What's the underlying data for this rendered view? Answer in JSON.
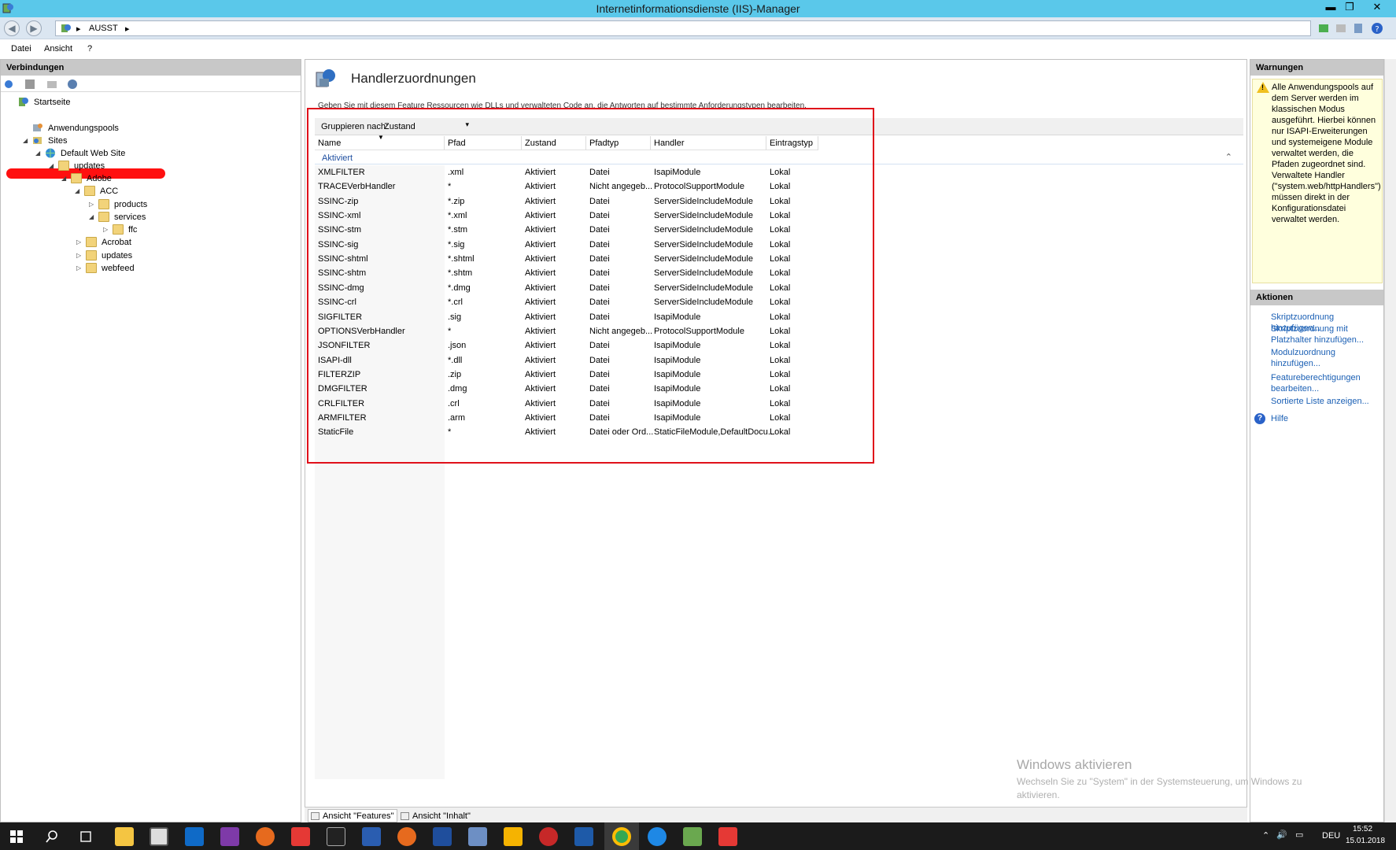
{
  "window": {
    "title": "Internetinformationsdienste (IIS)-Manager"
  },
  "address": {
    "crumb": "AUSST"
  },
  "menu": [
    "Datei",
    "Ansicht",
    "?"
  ],
  "connections": {
    "header": "Verbindungen",
    "tree": [
      {
        "label": "Startseite",
        "icon": "server-icon",
        "redacted": true
      },
      {
        "label": "Anwendungspools",
        "icon": "app-pools-icon"
      },
      {
        "label": "Sites",
        "icon": "sites-icon"
      },
      {
        "label": "Default Web Site",
        "icon": "globe-icon"
      },
      {
        "label": "updates",
        "icon": "folder-icon"
      },
      {
        "label": "Adobe",
        "icon": "folder-icon"
      },
      {
        "label": "ACC",
        "icon": "folder-icon"
      },
      {
        "label": "products",
        "icon": "folder-icon"
      },
      {
        "label": "services",
        "icon": "folder-icon"
      },
      {
        "label": "ffc",
        "icon": "folder-icon"
      },
      {
        "label": "Acrobat",
        "icon": "folder-icon"
      },
      {
        "label": "updates",
        "icon": "folder-icon"
      },
      {
        "label": "webfeed",
        "icon": "folder-icon"
      }
    ]
  },
  "feature": {
    "title": "Handlerzuordnungen",
    "description": "Geben Sie mit diesem Feature Ressourcen wie DLLs und verwalteten Code an, die Antworten auf bestimmte Anforderungstypen bearbeiten.",
    "group_by_label": "Gruppieren nach:",
    "group_by_value": "Zustand",
    "group_name": "Aktiviert",
    "columns": [
      "Name",
      "Pfad",
      "Zustand",
      "Pfadtyp",
      "Handler",
      "Eintragstyp"
    ],
    "rows": [
      [
        "XMLFILTER",
        ".xml",
        "Aktiviert",
        "Datei",
        "IsapiModule",
        "Lokal"
      ],
      [
        "TRACEVerbHandler",
        "*",
        "Aktiviert",
        "Nicht angegeb...",
        "ProtocolSupportModule",
        "Lokal"
      ],
      [
        "SSINC-zip",
        "*.zip",
        "Aktiviert",
        "Datei",
        "ServerSideIncludeModule",
        "Lokal"
      ],
      [
        "SSINC-xml",
        "*.xml",
        "Aktiviert",
        "Datei",
        "ServerSideIncludeModule",
        "Lokal"
      ],
      [
        "SSINC-stm",
        "*.stm",
        "Aktiviert",
        "Datei",
        "ServerSideIncludeModule",
        "Lokal"
      ],
      [
        "SSINC-sig",
        "*.sig",
        "Aktiviert",
        "Datei",
        "ServerSideIncludeModule",
        "Lokal"
      ],
      [
        "SSINC-shtml",
        "*.shtml",
        "Aktiviert",
        "Datei",
        "ServerSideIncludeModule",
        "Lokal"
      ],
      [
        "SSINC-shtm",
        "*.shtm",
        "Aktiviert",
        "Datei",
        "ServerSideIncludeModule",
        "Lokal"
      ],
      [
        "SSINC-dmg",
        "*.dmg",
        "Aktiviert",
        "Datei",
        "ServerSideIncludeModule",
        "Lokal"
      ],
      [
        "SSINC-crl",
        "*.crl",
        "Aktiviert",
        "Datei",
        "ServerSideIncludeModule",
        "Lokal"
      ],
      [
        "SIGFILTER",
        ".sig",
        "Aktiviert",
        "Datei",
        "IsapiModule",
        "Lokal"
      ],
      [
        "OPTIONSVerbHandler",
        "*",
        "Aktiviert",
        "Nicht angegeb...",
        "ProtocolSupportModule",
        "Lokal"
      ],
      [
        "JSONFILTER",
        ".json",
        "Aktiviert",
        "Datei",
        "IsapiModule",
        "Lokal"
      ],
      [
        "ISAPI-dll",
        "*.dll",
        "Aktiviert",
        "Datei",
        "IsapiModule",
        "Lokal"
      ],
      [
        "FILTERZIP",
        ".zip",
        "Aktiviert",
        "Datei",
        "IsapiModule",
        "Lokal"
      ],
      [
        "DMGFILTER",
        ".dmg",
        "Aktiviert",
        "Datei",
        "IsapiModule",
        "Lokal"
      ],
      [
        "CRLFILTER",
        ".crl",
        "Aktiviert",
        "Datei",
        "IsapiModule",
        "Lokal"
      ],
      [
        "ARMFILTER",
        ".arm",
        "Aktiviert",
        "Datei",
        "IsapiModule",
        "Lokal"
      ],
      [
        "StaticFile",
        "*",
        "Aktiviert",
        "Datei oder Ord...",
        "StaticFileModule,DefaultDocu...",
        "Lokal"
      ]
    ]
  },
  "view_tabs": [
    "Ansicht \"Features\"",
    "Ansicht \"Inhalt\""
  ],
  "warnings": {
    "header": "Warnungen",
    "text": "Alle Anwendungspools auf dem Server werden im klassischen Modus ausgeführt. Hierbei können nur ISAPI-Erweiterungen und systemeigene Module verwaltet werden, die Pfaden zugeordnet sind. Verwaltete Handler (\"system.web/httpHandlers\") müssen direkt in der Konfigurationsdatei verwaltet werden."
  },
  "actions": {
    "header": "Aktionen",
    "items": [
      "Skriptzuordnung hinzufügen...",
      "Skriptzuordnung mit Platzhalter hinzufügen...",
      "Modulzuordnung hinzufügen...",
      "Featureberechtigungen bearbeiten...",
      "Sortierte Liste anzeigen...",
      "Hilfe"
    ]
  },
  "watermark": {
    "title": "Windows aktivieren",
    "text": "Wechseln Sie zu \"System\" in der Systemsteuerung, um Windows zu aktivieren."
  },
  "taskbar": {
    "language": "DEU",
    "time": "15:52",
    "date": "15.01.2018"
  },
  "colors": {
    "titlebar": "#5ac8ea",
    "highlight": "#e0101a",
    "link": "#1a5fb4",
    "group": "#1f4fa0"
  }
}
